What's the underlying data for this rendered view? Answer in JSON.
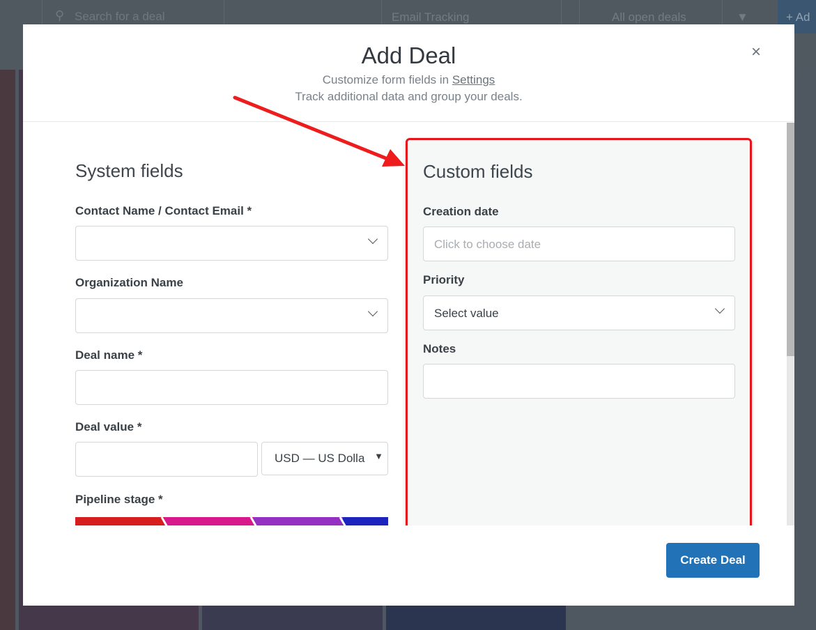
{
  "background": {
    "search_placeholder": "Search for a deal",
    "pipeline_select": "Email Tracking",
    "filter_select": "All open deals",
    "add_button": "+ Ad"
  },
  "modal": {
    "title": "Add Deal",
    "subtitle_prefix": "Customize form fields in ",
    "settings_link": "Settings",
    "subtitle_line2": "Track additional data and group your deals.",
    "close_icon": "×"
  },
  "system": {
    "title": "System fields",
    "contact_label": "Contact Name / Contact Email *",
    "contact_value": "",
    "org_label": "Organization Name",
    "org_value": "",
    "deal_name_label": "Deal name *",
    "deal_name_value": "",
    "deal_value_label": "Deal value *",
    "deal_value_value": "",
    "currency": "USD — US Dolla",
    "pipeline_label": "Pipeline stage *",
    "pipeline_colors": [
      "#d61e1e",
      "#d8198c",
      "#9430c2",
      "#1c24bd"
    ]
  },
  "custom": {
    "title": "Custom fields",
    "creation_label": "Creation date",
    "creation_placeholder": "Click to choose date",
    "priority_label": "Priority",
    "priority_value": "Select value",
    "notes_label": "Notes",
    "notes_value": ""
  },
  "footer": {
    "create_label": "Create Deal"
  },
  "colors": {
    "accent": "#2272b7",
    "highlight": "#e8141b"
  }
}
